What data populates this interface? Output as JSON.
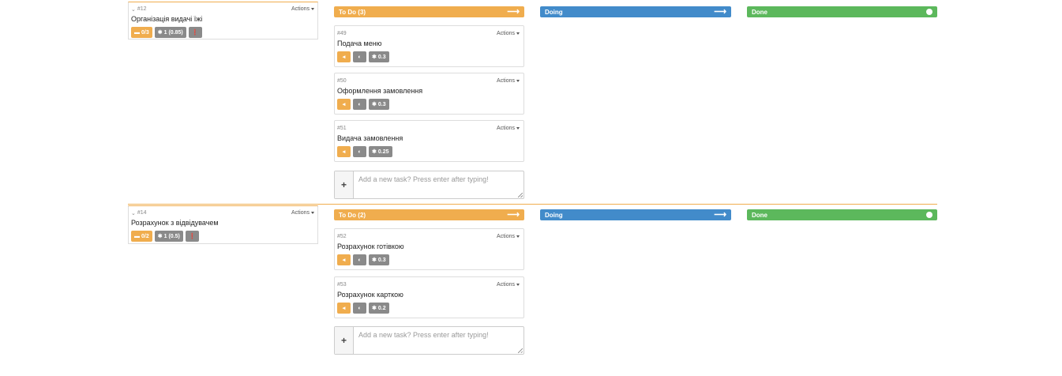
{
  "placeholders": {
    "new_task": "Add a new task? Press enter after typing!"
  },
  "actions_label": "Actions",
  "columns": {
    "todo_1": "To Do (3)",
    "todo_2": "To Do (2)",
    "doing": "Doing",
    "done": "Done"
  },
  "stories": [
    {
      "id": "#12",
      "title": "Організація видачі їжі",
      "tasks_badge": "0/3",
      "points_badge": "1 (0.85)"
    },
    {
      "id": "#14",
      "title": "Розрахунок з відвідувачем",
      "tasks_badge": "0/2",
      "points_badge": "1 (0.5)"
    }
  ],
  "tasks": [
    {
      "id": "#49",
      "title": "Подача меню",
      "points": "0.3"
    },
    {
      "id": "#50",
      "title": "Оформлення замовлення",
      "points": "0.3"
    },
    {
      "id": "#51",
      "title": "Видача замовлення",
      "points": "0.25"
    },
    {
      "id": "#52",
      "title": "Розрахунок готівкою",
      "points": "0.3"
    },
    {
      "id": "#53",
      "title": "Розрахунок карткою",
      "points": "0.2"
    }
  ],
  "colors": {
    "todo": "#f0ad4e",
    "doing": "#428bca",
    "done": "#5cb85c",
    "badge_grey": "#8a8a8a"
  },
  "icons": {
    "chevron": "chevron-down-icon",
    "folder": "folder-icon",
    "gear": "gear-icon",
    "info": "info-icon",
    "arrow": "arrow-right-icon",
    "dot": "circle-icon",
    "play_back": "caret-left-icon",
    "half": "half-circle-icon",
    "plus": "plus-icon"
  }
}
